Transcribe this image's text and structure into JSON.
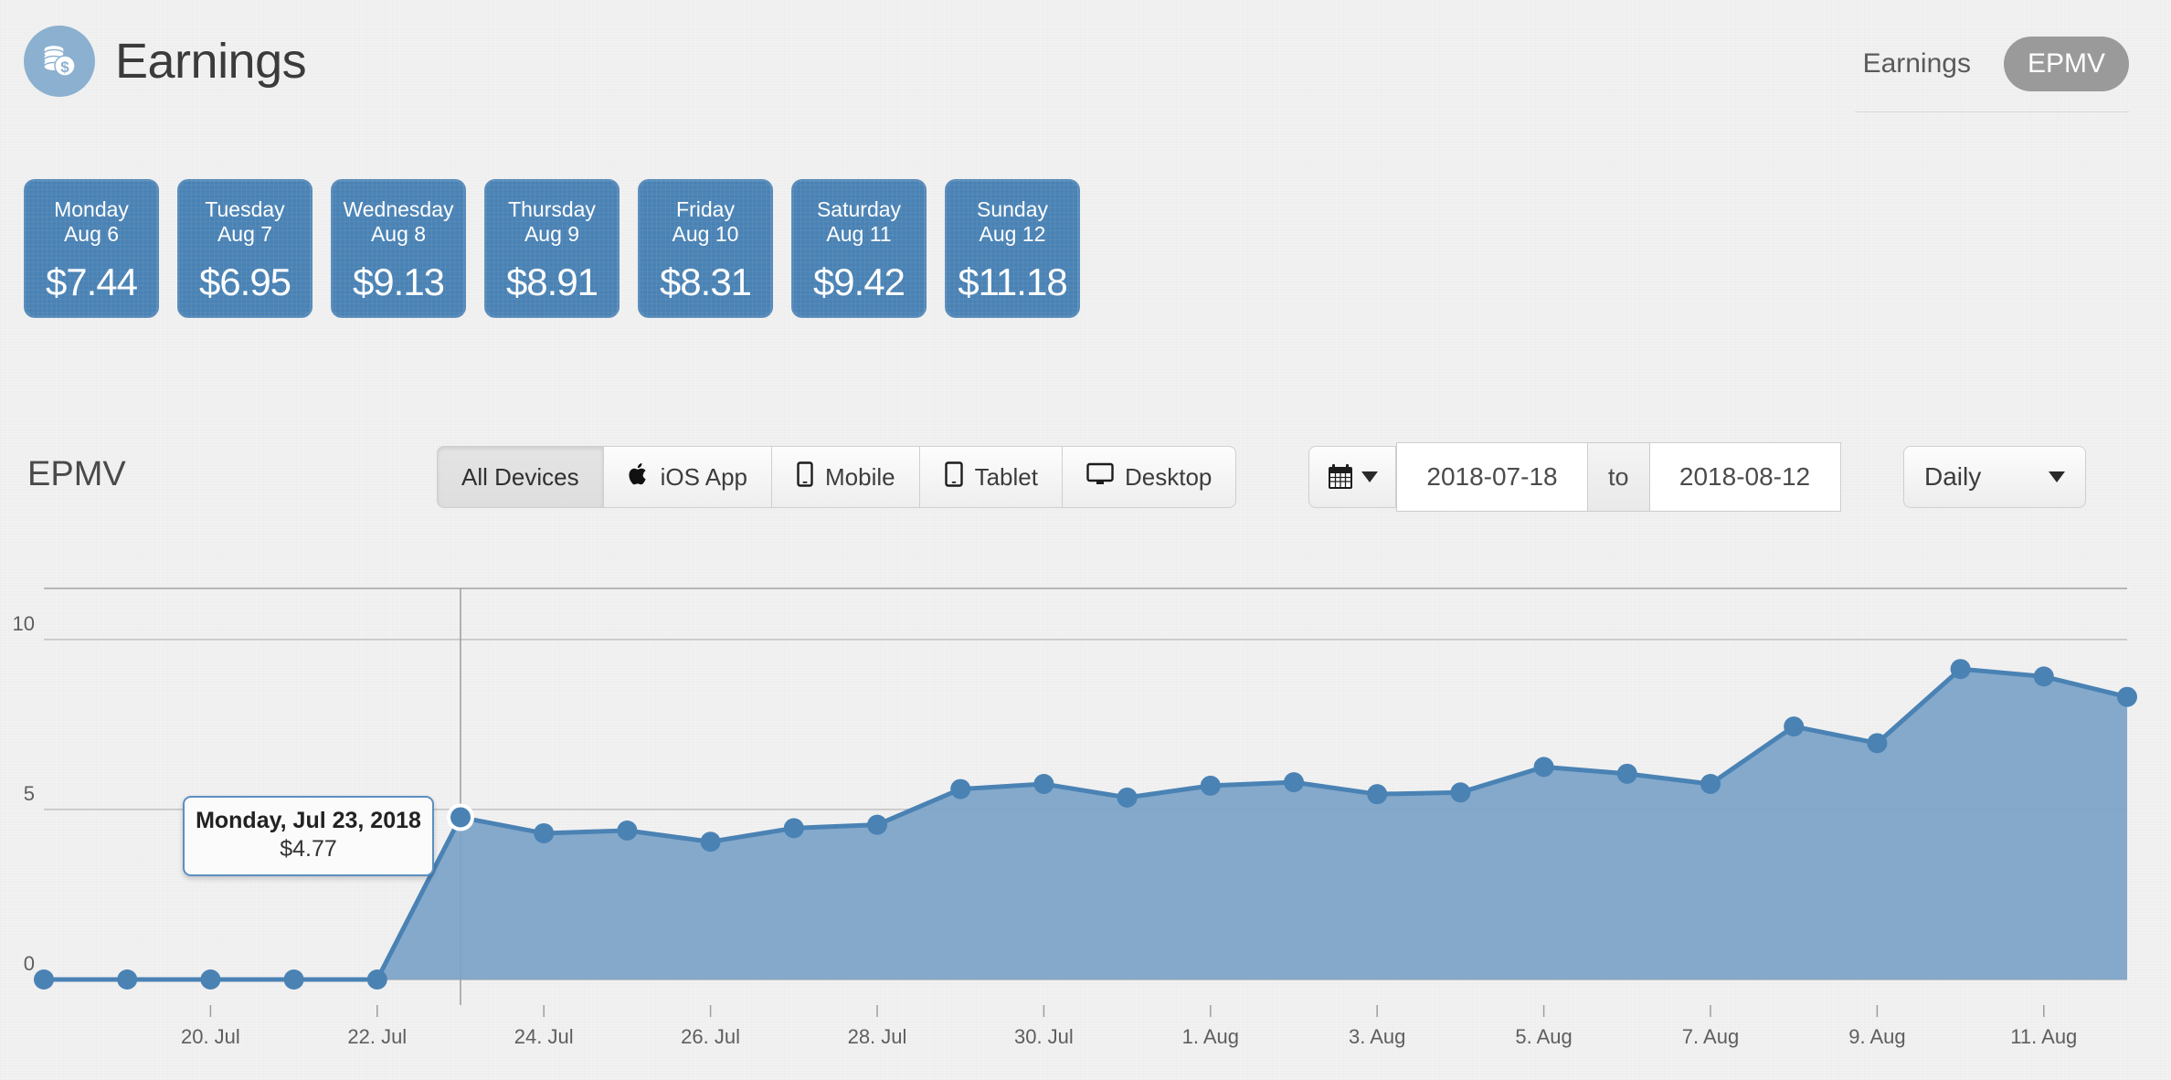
{
  "header": {
    "title": "Earnings",
    "logo_icon": "coins-icon",
    "toggle": {
      "inactive": "Earnings",
      "active": "EPMV"
    }
  },
  "day_cards": [
    {
      "dow": "Monday",
      "date": "Aug 6",
      "amount": "$7.44"
    },
    {
      "dow": "Tuesday",
      "date": "Aug 7",
      "amount": "$6.95"
    },
    {
      "dow": "Wednesday",
      "date": "Aug 8",
      "amount": "$9.13"
    },
    {
      "dow": "Thursday",
      "date": "Aug 9",
      "amount": "$8.91"
    },
    {
      "dow": "Friday",
      "date": "Aug 10",
      "amount": "$8.31"
    },
    {
      "dow": "Saturday",
      "date": "Aug 11",
      "amount": "$9.42"
    },
    {
      "dow": "Sunday",
      "date": "Aug 12",
      "amount": "$11.18"
    }
  ],
  "controls": {
    "section_label": "EPMV",
    "devices": [
      {
        "label": "All Devices",
        "icon": "none",
        "active": true
      },
      {
        "label": "iOS App",
        "icon": "apple-icon",
        "active": false
      },
      {
        "label": "Mobile",
        "icon": "phone-icon",
        "active": false
      },
      {
        "label": "Tablet",
        "icon": "tablet-icon",
        "active": false
      },
      {
        "label": "Desktop",
        "icon": "desktop-icon",
        "active": false
      }
    ],
    "date_from": "2018-07-18",
    "date_to": "2018-08-12",
    "to_label": "to",
    "interval": "Daily",
    "calendar_icon": "calendar-icon"
  },
  "tooltip": {
    "title": "Monday, Jul 23, 2018",
    "value": "$4.77"
  },
  "colors": {
    "card_blue": "#4a82b4",
    "area_fill": "#7ba3c8",
    "line": "#4a82b4",
    "accent_gray": "#9a9a9a",
    "background": "#f2f2f2"
  },
  "chart_data": {
    "type": "area",
    "title": "EPMV",
    "xlabel": "",
    "ylabel": "",
    "ylim": [
      0,
      11.5
    ],
    "grid": true,
    "legend": "none",
    "y_ticks": [
      "0",
      "5",
      "10"
    ],
    "y_tick_values": [
      0,
      5,
      10
    ],
    "x_ticks": [
      "20. Jul",
      "22. Jul",
      "24. Jul",
      "26. Jul",
      "28. Jul",
      "30. Jul",
      "1. Aug",
      "3. Aug",
      "5. Aug",
      "7. Aug",
      "9. Aug",
      "11. Aug"
    ],
    "highlight_index": 5,
    "x": [
      "2018-07-18",
      "2018-07-19",
      "2018-07-20",
      "2018-07-21",
      "2018-07-22",
      "2018-07-23",
      "2018-07-24",
      "2018-07-25",
      "2018-07-26",
      "2018-07-27",
      "2018-07-28",
      "2018-07-29",
      "2018-07-30",
      "2018-07-31",
      "2018-08-01",
      "2018-08-02",
      "2018-08-03",
      "2018-08-04",
      "2018-08-05",
      "2018-08-06",
      "2018-08-07",
      "2018-08-08",
      "2018-08-09",
      "2018-08-10",
      "2018-08-11",
      "2018-08-12"
    ],
    "values": [
      0,
      0,
      0,
      0,
      0,
      4.77,
      4.3,
      4.38,
      4.05,
      4.45,
      4.55,
      5.6,
      5.75,
      5.35,
      5.7,
      5.8,
      5.45,
      5.5,
      6.25,
      6.05,
      5.75,
      7.44,
      6.95,
      9.13,
      8.91,
      8.31
    ]
  }
}
